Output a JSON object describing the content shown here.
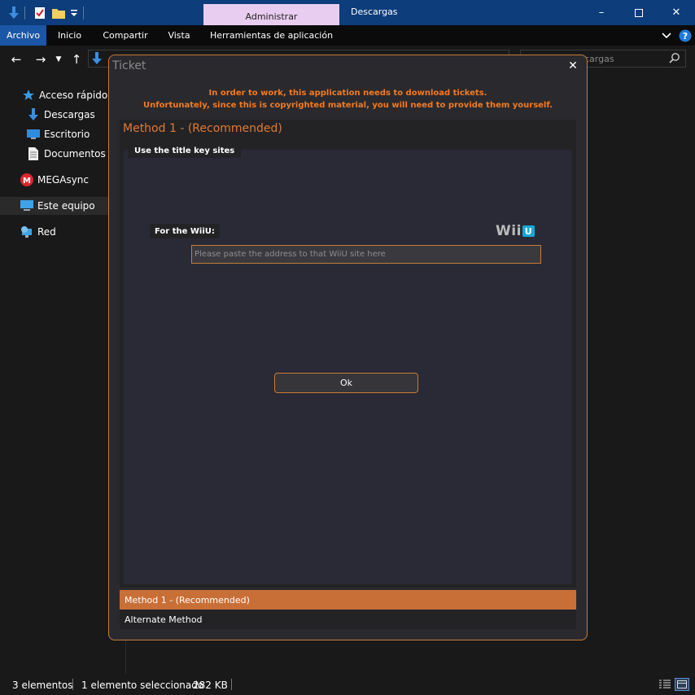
{
  "titlebar": {
    "contextual_tab": "Administrar",
    "window_title": "Descargas",
    "quick_access_icons": [
      "download-arrow-icon",
      "properties-checklist-icon",
      "new-folder-icon",
      "customize-dropdown-icon"
    ],
    "controls": [
      "minimize-icon",
      "maximize-icon",
      "close-icon"
    ]
  },
  "ribbon": {
    "tabs": [
      "Archivo",
      "Inicio",
      "Compartir",
      "Vista",
      "Herramientas de aplicación"
    ],
    "active_tab": "Archivo"
  },
  "search": {
    "placeholder": "cargas"
  },
  "sidebar": {
    "items": [
      {
        "label": "Acceso rápido",
        "icon": "star-icon"
      },
      {
        "label": "Descargas",
        "icon": "download-icon"
      },
      {
        "label": "Escritorio",
        "icon": "desktop-icon"
      },
      {
        "label": "Documentos",
        "icon": "document-icon"
      },
      {
        "label": "MEGAsync",
        "icon": "mega-icon"
      },
      {
        "label": "Este equipo",
        "icon": "computer-icon"
      },
      {
        "label": "Red",
        "icon": "network-icon"
      }
    ],
    "selected": "Este equipo"
  },
  "status": {
    "count": "3 elementos",
    "selection": "1 elemento seleccionado",
    "size": "282 KB"
  },
  "dialog": {
    "title": "Ticket",
    "notice_line1": "In order to work, this application needs to download tickets.",
    "notice_line2": "Unfortunately, since this is copyrighted material, you will need to provide them yourself.",
    "method_header": "Method 1 - (Recommended)",
    "group_label": "Use the title key sites",
    "wiiu_label": "For the WiiU:",
    "wiiu_logo_text": "Wii",
    "wiiu_logo_u": "U",
    "input_placeholder": "Please paste the address to that WiiU site here",
    "ok_label": "Ok",
    "methods": [
      "Method 1 - (Recommended)",
      "Alternate Method"
    ],
    "selected_method": "Method 1 - (Recommended)"
  },
  "colors": {
    "accent_orange": "#f47a20",
    "selected_row": "#c86f37",
    "titlebar_blue": "#0d3d7a",
    "contextual_tab": "#e9cdf0",
    "active_ribbon_tab": "#1c56a6"
  }
}
